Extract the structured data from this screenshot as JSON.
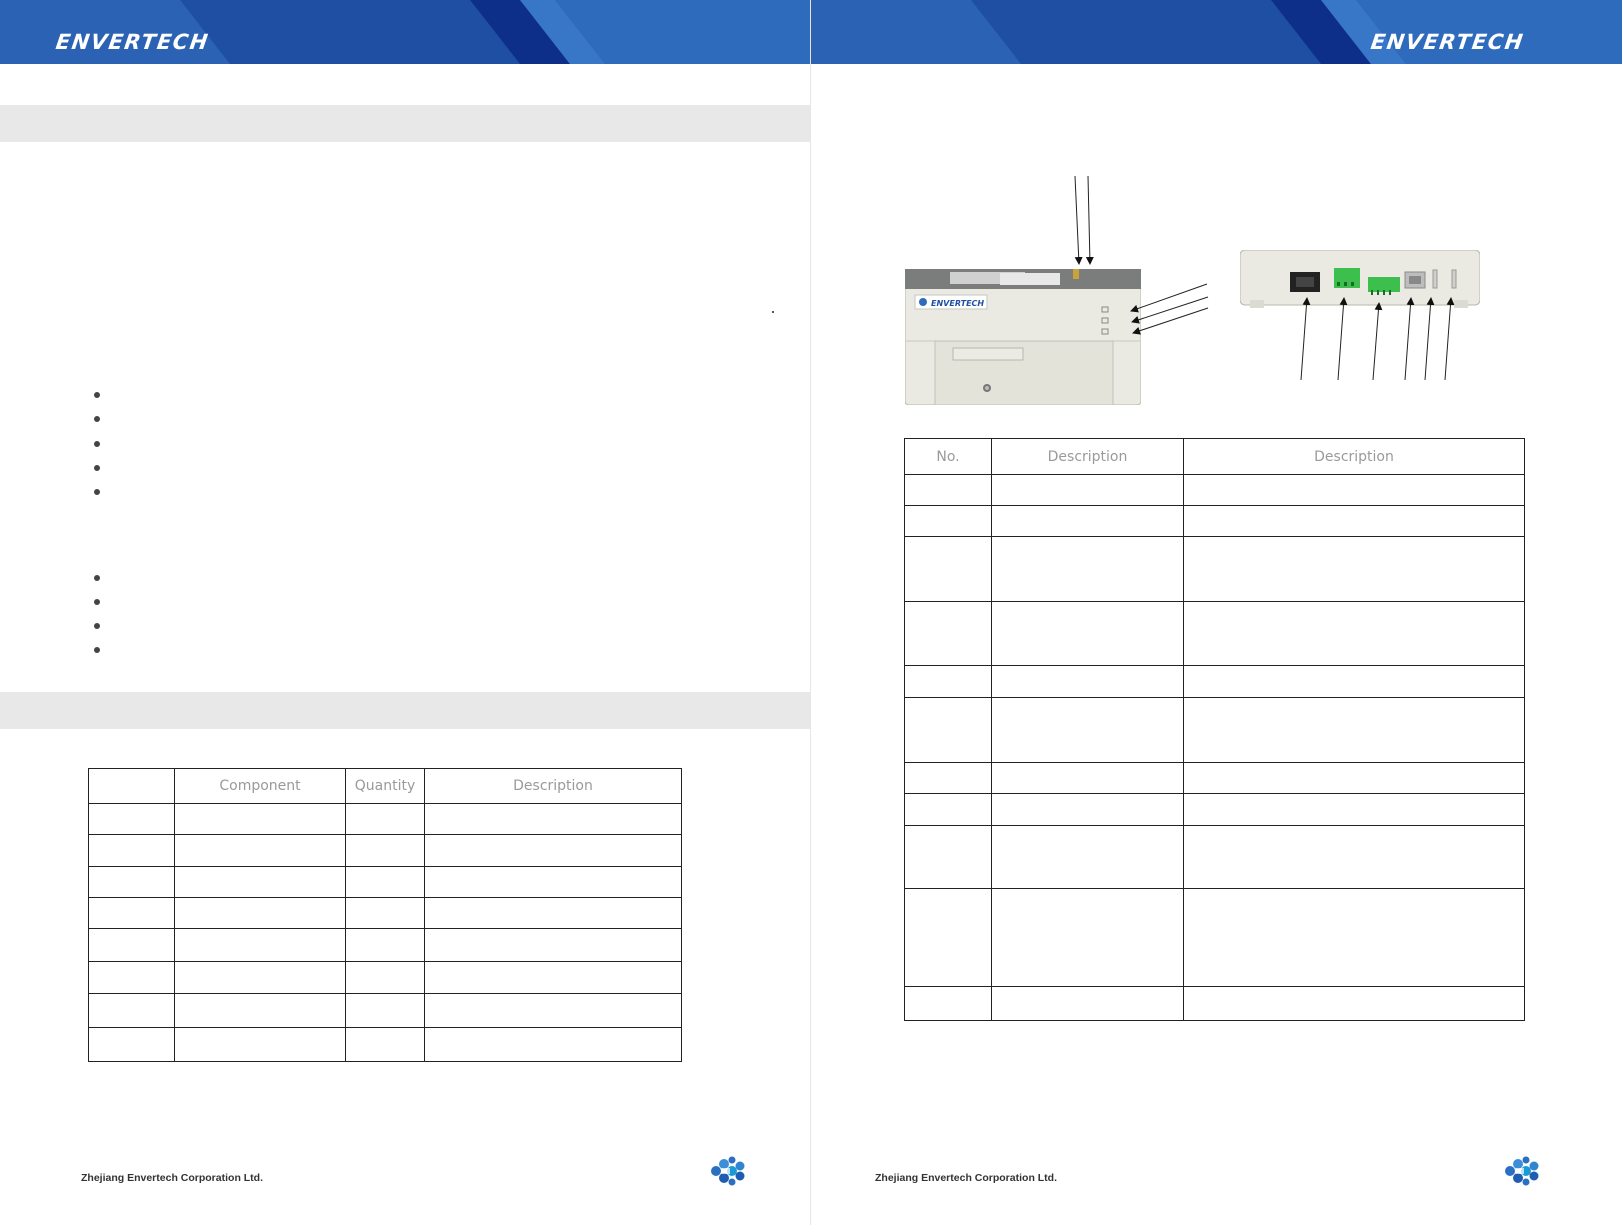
{
  "header": {
    "logo_text": "ENVERTECH",
    "colors": {
      "band": "#2a63b4",
      "dark_stripe": "#0d2f8a",
      "light_stripe": "#3877c8"
    }
  },
  "left_page": {
    "bullets_group_1_count": 5,
    "bullets_group_2_count": 4,
    "components_table": {
      "headers": [
        "",
        "Component",
        "Quantity",
        "Description"
      ],
      "rows": 8
    },
    "footer": {
      "company": "Zhejiang Envertech Corporation Ltd."
    }
  },
  "right_page": {
    "device": {
      "front_brand": "ENVERTECH",
      "led_labels": [
        "",
        "",
        ""
      ]
    },
    "description_table": {
      "headers": [
        "No.",
        "Description",
        "Description"
      ],
      "rows": 11
    },
    "footer": {
      "company": "Zhejiang Envertech Corporation Ltd."
    }
  },
  "icons": [
    "envertech-logo-icon",
    "envertech-logo-icon"
  ]
}
